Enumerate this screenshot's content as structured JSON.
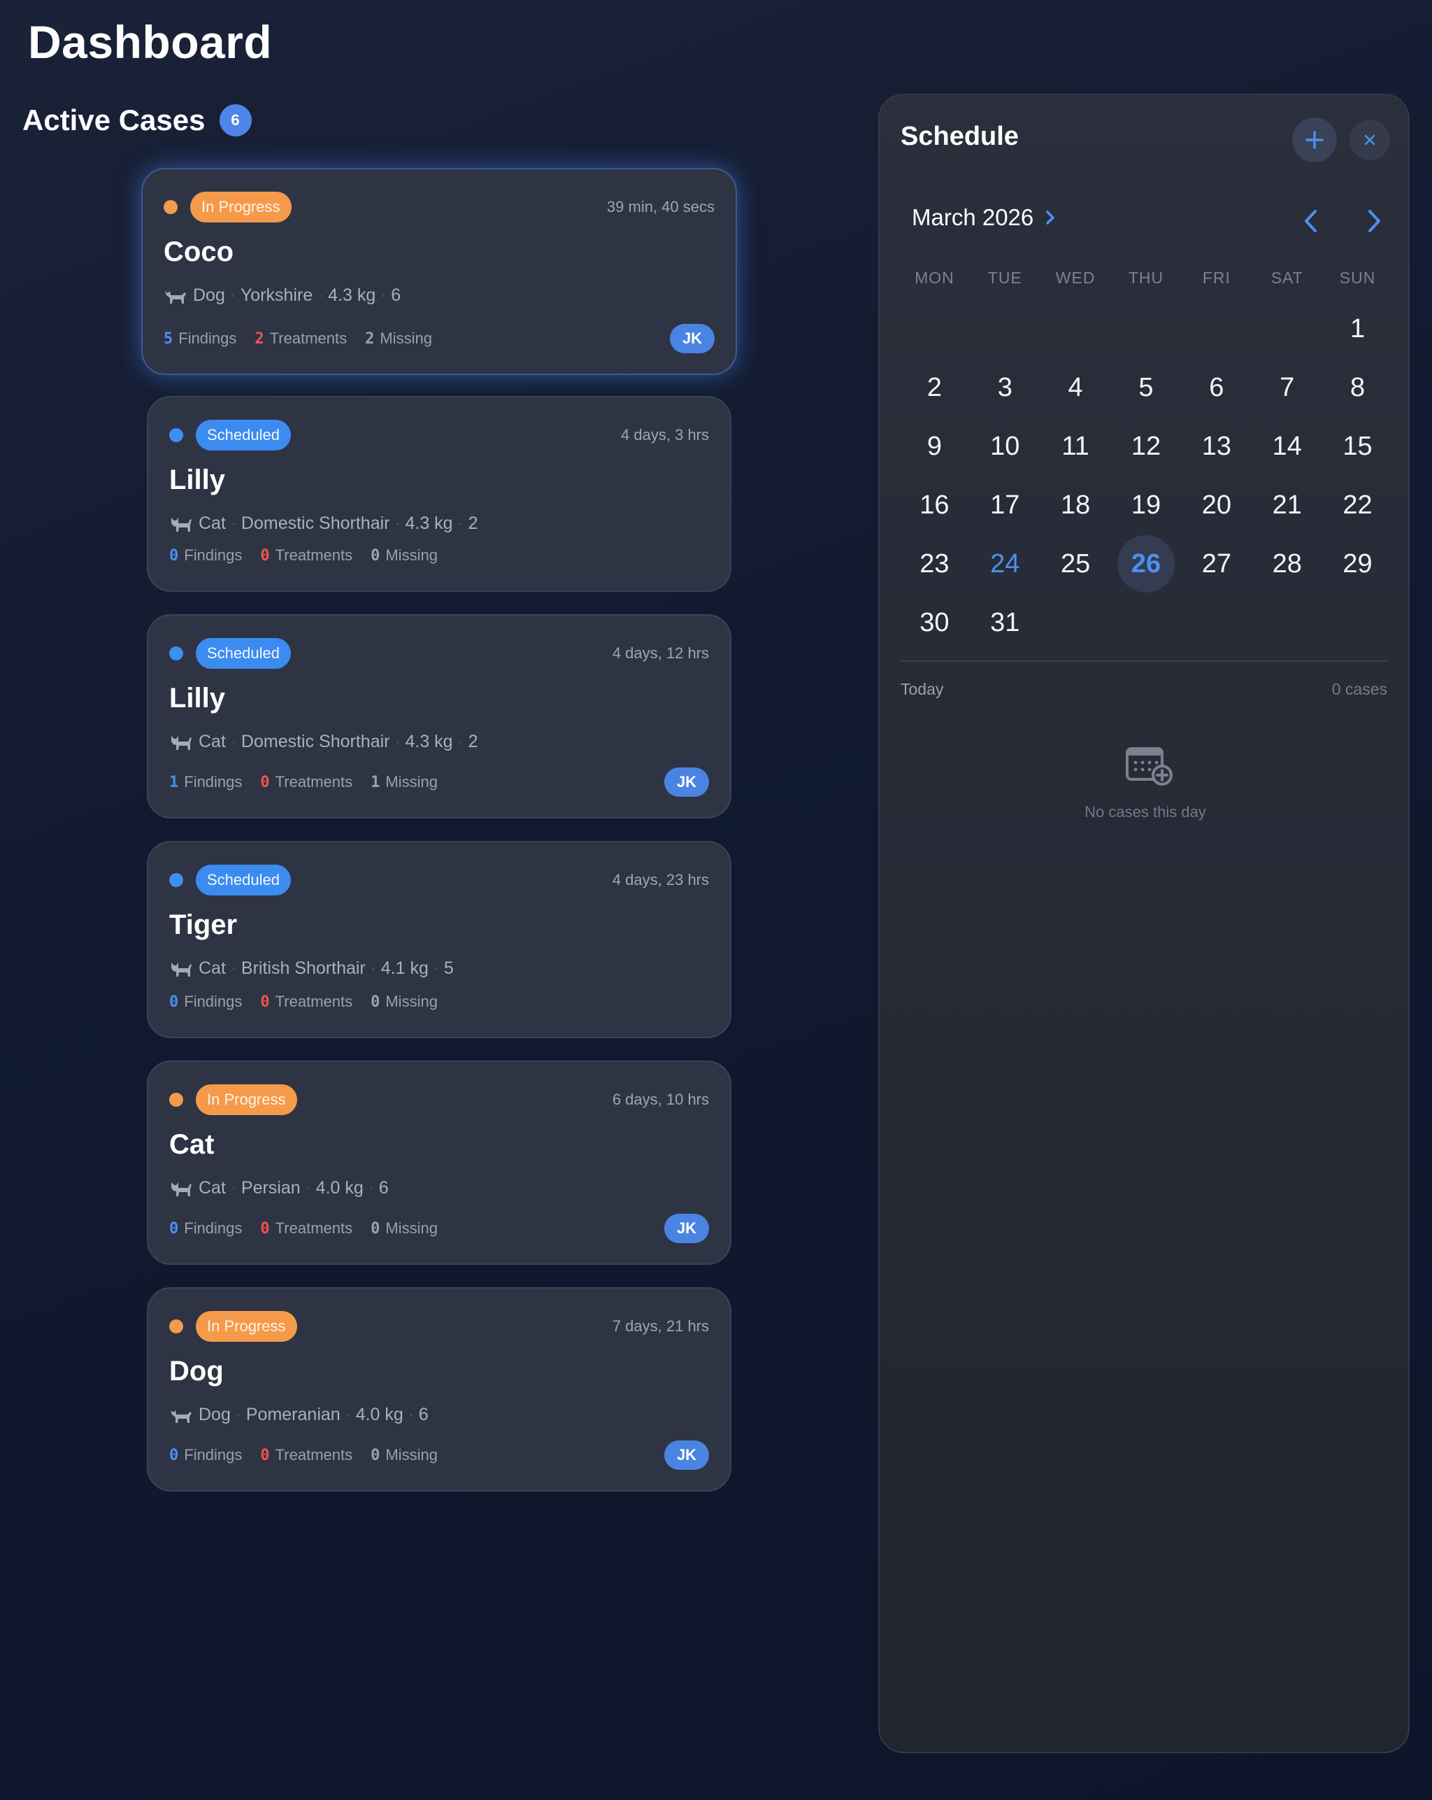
{
  "page": {
    "title": "Dashboard"
  },
  "active_cases": {
    "title": "Active Cases",
    "count": "6",
    "cards": [
      {
        "status": "In Progress",
        "status_color": "#f59a4a",
        "duration": "39 min, 40 secs",
        "name": "Coco",
        "species": "Dog",
        "species_icon": "dog-icon",
        "breed": "Yorkshire",
        "weight": "4.3 kg",
        "age": "6",
        "findings_count": "5",
        "findings_label": "Findings",
        "treatments_count": "2",
        "treatments_label": "Treatments",
        "missing_count": "2",
        "missing_label": "Missing",
        "assignee": "JK"
      },
      {
        "status": "Scheduled",
        "status_color": "#3c8bf0",
        "duration": "4 days, 3 hrs",
        "name": "Lilly",
        "species": "Cat",
        "species_icon": "cat-icon",
        "breed": "Domestic Shorthair",
        "weight": "4.3 kg",
        "age": "2",
        "findings_count": "0",
        "findings_label": "Findings",
        "treatments_count": "0",
        "treatments_label": "Treatments",
        "missing_count": "0",
        "missing_label": "Missing",
        "assignee": ""
      },
      {
        "status": "Scheduled",
        "status_color": "#3c8bf0",
        "duration": "4 days, 12 hrs",
        "name": "Lilly",
        "species": "Cat",
        "species_icon": "cat-icon",
        "breed": "Domestic Shorthair",
        "weight": "4.3 kg",
        "age": "2",
        "findings_count": "1",
        "findings_label": "Findings",
        "treatments_count": "0",
        "treatments_label": "Treatments",
        "missing_count": "1",
        "missing_label": "Missing",
        "assignee": "JK"
      },
      {
        "status": "Scheduled",
        "status_color": "#3c8bf0",
        "duration": "4 days, 23 hrs",
        "name": "Tiger",
        "species": "Cat",
        "species_icon": "cat-icon",
        "breed": "British Shorthair",
        "weight": "4.1 kg",
        "age": "5",
        "findings_count": "0",
        "findings_label": "Findings",
        "treatments_count": "0",
        "treatments_label": "Treatments",
        "missing_count": "0",
        "missing_label": "Missing",
        "assignee": ""
      },
      {
        "status": "In Progress",
        "status_color": "#f59a4a",
        "duration": "6 days, 10 hrs",
        "name": "Cat",
        "species": "Cat",
        "species_icon": "cat-icon",
        "breed": "Persian",
        "weight": "4.0 kg",
        "age": "6",
        "findings_count": "0",
        "findings_label": "Findings",
        "treatments_count": "0",
        "treatments_label": "Treatments",
        "missing_count": "0",
        "missing_label": "Missing",
        "assignee": "JK"
      },
      {
        "status": "In Progress",
        "status_color": "#f59a4a",
        "duration": "7 days, 21 hrs",
        "name": "Dog",
        "species": "Dog",
        "species_icon": "dog-icon",
        "breed": "Pomeranian",
        "weight": "4.0 kg",
        "age": "6",
        "findings_count": "0",
        "findings_label": "Findings",
        "treatments_count": "0",
        "treatments_label": "Treatments",
        "missing_count": "0",
        "missing_label": "Missing",
        "assignee": "JK"
      }
    ]
  },
  "schedule": {
    "title": "Schedule",
    "add_icon": "plus-icon",
    "close_icon": "close-icon",
    "month": "March 2026",
    "weekdays": [
      "MON",
      "TUE",
      "WED",
      "THU",
      "FRI",
      "SAT",
      "SUN"
    ],
    "days": [
      "",
      "",
      "",
      "",
      "",
      "",
      "1",
      "2",
      "3",
      "4",
      "5",
      "6",
      "7",
      "8",
      "9",
      "10",
      "11",
      "12",
      "13",
      "14",
      "15",
      "16",
      "17",
      "18",
      "19",
      "20",
      "21",
      "22",
      "23",
      "24",
      "25",
      "26",
      "27",
      "28",
      "29",
      "30",
      "31"
    ],
    "today": "24",
    "selected": "26",
    "accent_color": "#4d8ff2",
    "day_label": "Today",
    "cases_count": "0 cases",
    "empty_icon": "calendar-add-icon",
    "empty_text": "No cases this day"
  }
}
